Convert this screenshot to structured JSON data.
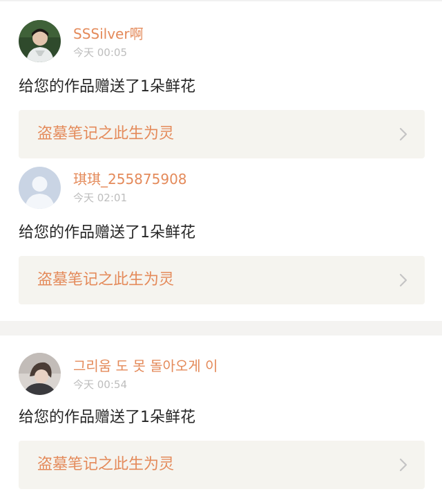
{
  "notifications": [
    {
      "user": "SSSilver啊",
      "time": "今天 00:05",
      "message": "给您的作品赠送了1朵鲜花",
      "work_title": "盗墓笔记之此生为灵",
      "avatar": "photo-avatar"
    },
    {
      "user": "琪琪_255875908",
      "time": "今天 02:01",
      "message": "给您的作品赠送了1朵鲜花",
      "work_title": "盗墓笔记之此生为灵",
      "avatar": "default-user-avatar"
    },
    {
      "user": "그리움 도 못 돌아오게 이",
      "time": "今天 00:54",
      "message": "给您的作品赠送了1朵鲜花",
      "work_title": "盗墓笔记之此生为灵",
      "avatar": "photo-avatar"
    }
  ],
  "colors": {
    "accent": "#e48a5a",
    "muted": "#bdbdbd",
    "text": "#262626",
    "card_bg": "#f5f4ef",
    "separator": "#f4f3f1"
  },
  "icons": {
    "chevron": "chevron-right-icon"
  }
}
